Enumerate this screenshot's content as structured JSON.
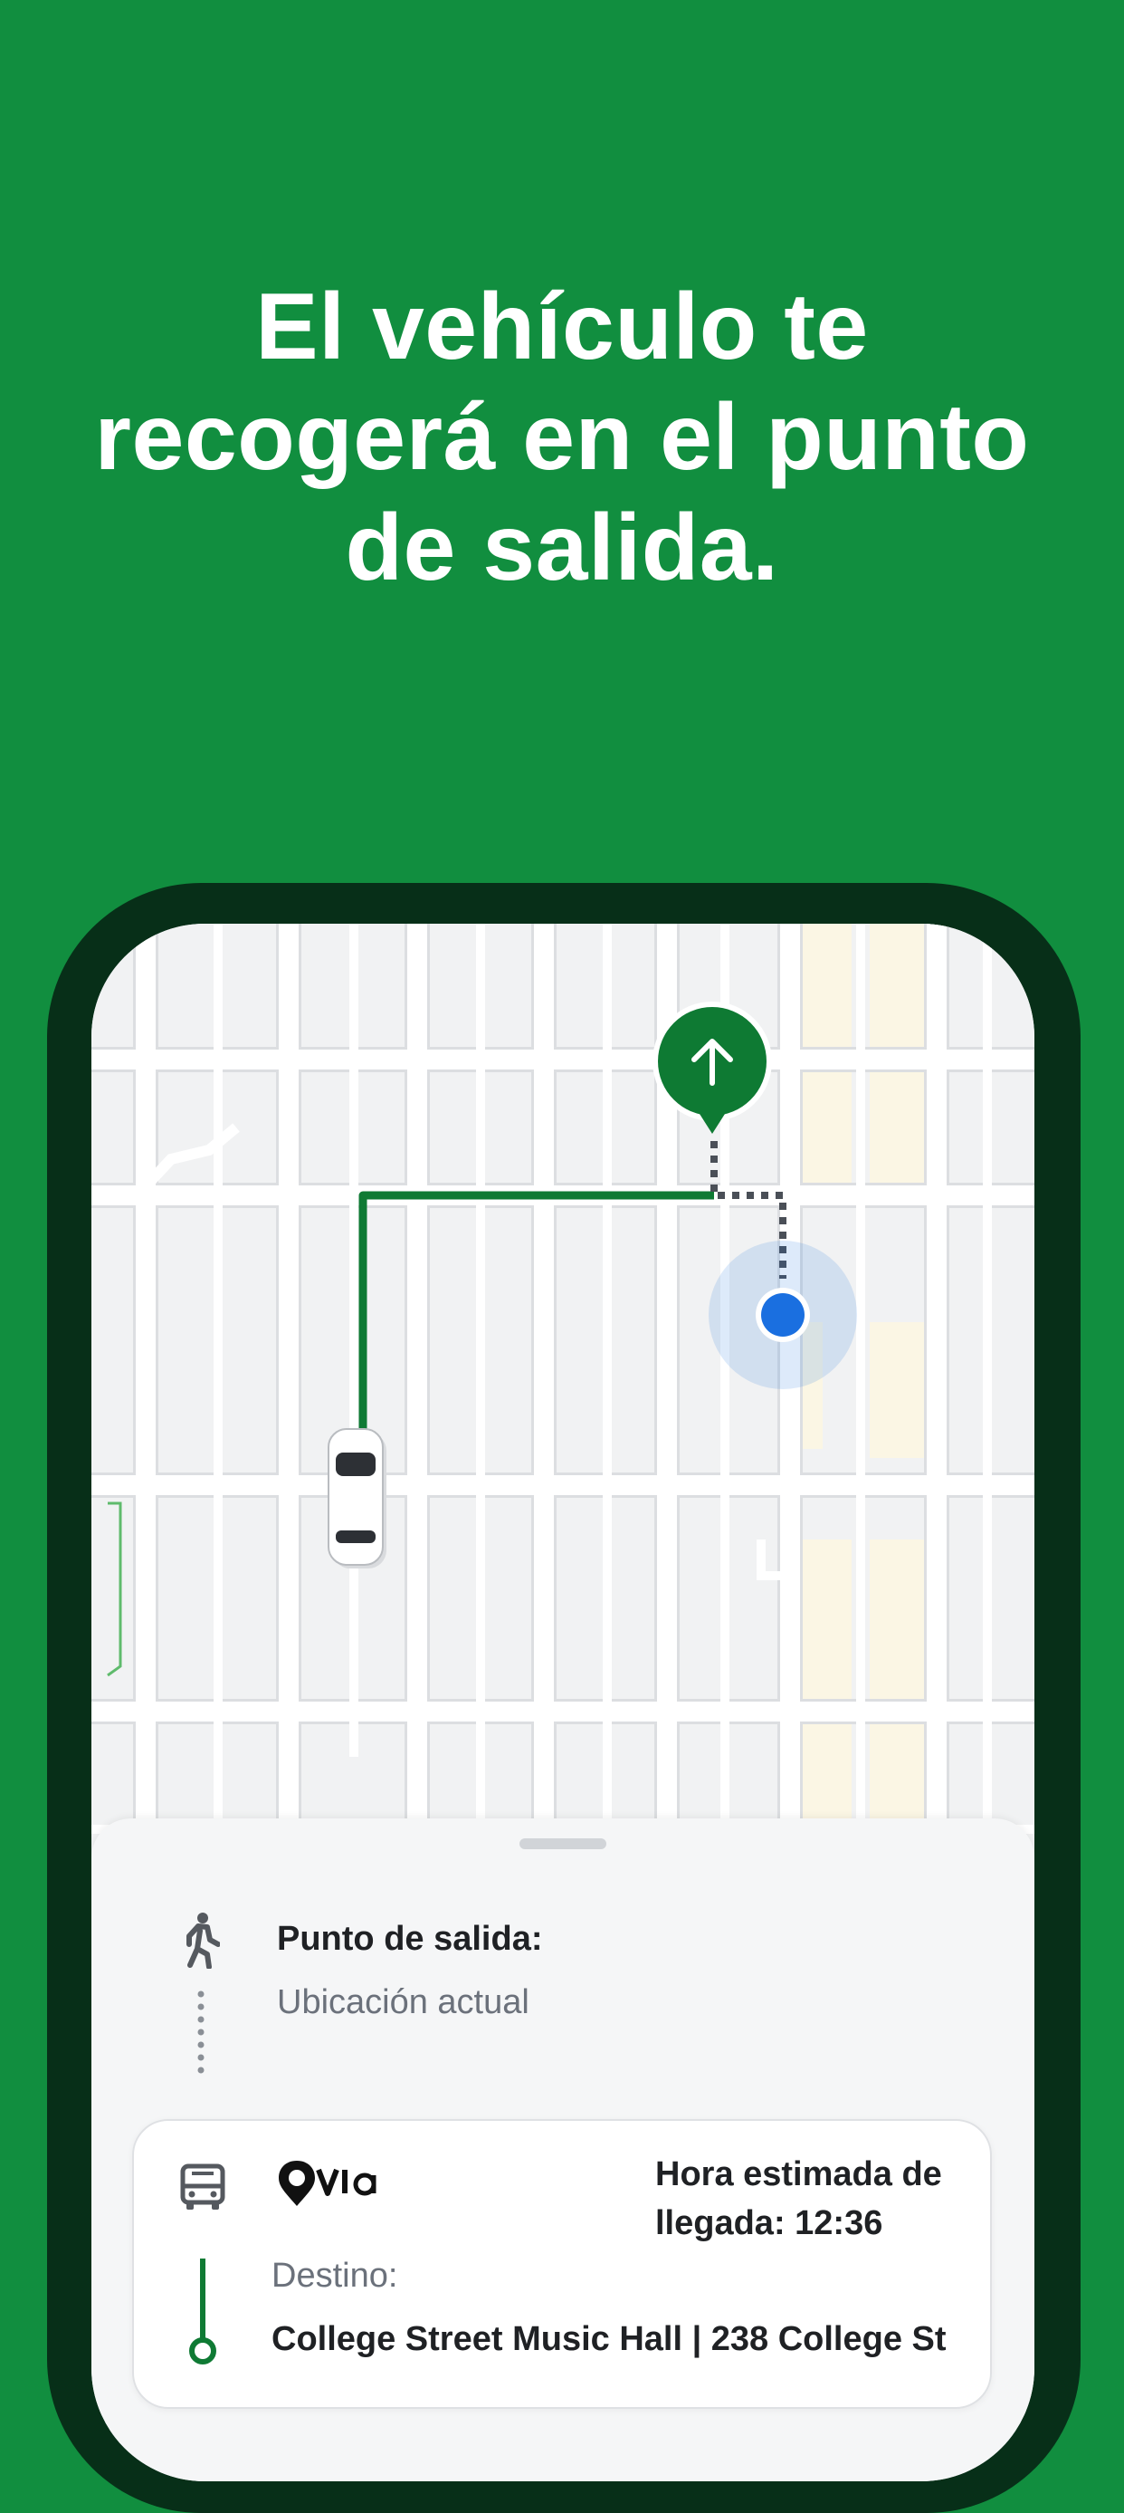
{
  "headline": "El vehículo te recogerá en el punto de salida.",
  "colors": {
    "background": "#118e3f",
    "phone_frame": "#072f18",
    "route_green": "#0f7a34",
    "pin_green": "#0e7a33",
    "user_location_blue": "#1a6fe0"
  },
  "map": {
    "icons": [
      "pickup-arrow-pin-icon",
      "vehicle-car-icon",
      "user-location-icon"
    ]
  },
  "sheet": {
    "pickup_label": "Punto de salida:",
    "pickup_value": "Ubicación actual",
    "walk_icon": "walking-person-icon",
    "ride_card": {
      "vehicle_icon": "bus-icon",
      "brand_logo": "via-logo",
      "eta": "Hora estimada de llegada: 12:36",
      "destination_label": "Destino:",
      "destination_value": "College Street Music Hall | 238 College St"
    }
  }
}
